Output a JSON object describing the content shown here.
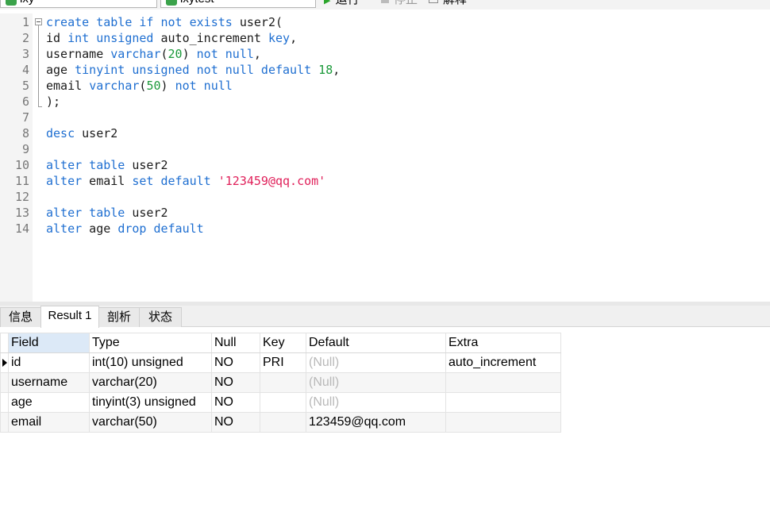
{
  "toolbar": {
    "connection": "lxy",
    "database": "lxytest",
    "run_label": "运行",
    "stop_label": "停止",
    "explain_label": "解释"
  },
  "editor": {
    "line_numbers": [
      "1",
      "2",
      "3",
      "4",
      "5",
      "6",
      "7",
      "8",
      "9",
      "10",
      "11",
      "12",
      "13",
      "14"
    ],
    "lines": [
      [
        {
          "t": "create table if not exists",
          "c": "kw"
        },
        {
          "t": " user2(",
          "c": "id"
        }
      ],
      [
        {
          "t": "id ",
          "c": "id"
        },
        {
          "t": "int unsigned",
          "c": "kw"
        },
        {
          "t": " auto_increment ",
          "c": "id"
        },
        {
          "t": "key",
          "c": "kw"
        },
        {
          "t": ",",
          "c": "id"
        }
      ],
      [
        {
          "t": "username ",
          "c": "id"
        },
        {
          "t": "varchar",
          "c": "kw"
        },
        {
          "t": "(",
          "c": "id"
        },
        {
          "t": "20",
          "c": "num"
        },
        {
          "t": ") ",
          "c": "id"
        },
        {
          "t": "not null",
          "c": "kw"
        },
        {
          "t": ",",
          "c": "id"
        }
      ],
      [
        {
          "t": "age ",
          "c": "id"
        },
        {
          "t": "tinyint unsigned not null default",
          "c": "kw"
        },
        {
          "t": " ",
          "c": "id"
        },
        {
          "t": "18",
          "c": "num"
        },
        {
          "t": ",",
          "c": "id"
        }
      ],
      [
        {
          "t": "email ",
          "c": "id"
        },
        {
          "t": "varchar",
          "c": "kw"
        },
        {
          "t": "(",
          "c": "id"
        },
        {
          "t": "50",
          "c": "num"
        },
        {
          "t": ") ",
          "c": "id"
        },
        {
          "t": "not null",
          "c": "kw"
        }
      ],
      [
        {
          "t": ");",
          "c": "id"
        }
      ],
      [],
      [
        {
          "t": "desc",
          "c": "kw"
        },
        {
          "t": " user2",
          "c": "id"
        }
      ],
      [],
      [
        {
          "t": "alter table",
          "c": "kw"
        },
        {
          "t": " user2",
          "c": "id"
        }
      ],
      [
        {
          "t": "alter",
          "c": "kw"
        },
        {
          "t": " email ",
          "c": "id"
        },
        {
          "t": "set default",
          "c": "kw"
        },
        {
          "t": " ",
          "c": "id"
        },
        {
          "t": "'123459@qq.com'",
          "c": "str"
        }
      ],
      [],
      [
        {
          "t": "alter table",
          "c": "kw"
        },
        {
          "t": " user2",
          "c": "id"
        }
      ],
      [
        {
          "t": "alter",
          "c": "kw"
        },
        {
          "t": " age ",
          "c": "id"
        },
        {
          "t": "drop default",
          "c": "kw"
        }
      ]
    ]
  },
  "result_tabs": [
    "信息",
    "Result 1",
    "剖析",
    "状态"
  ],
  "grid": {
    "columns": [
      "Field",
      "Type",
      "Null",
      "Key",
      "Default",
      "Extra"
    ],
    "rows": [
      [
        "id",
        "int(10) unsigned",
        "NO",
        "PRI",
        "(Null)",
        "auto_increment"
      ],
      [
        "username",
        "varchar(20)",
        "NO",
        "",
        "(Null)",
        ""
      ],
      [
        "age",
        "tinyint(3) unsigned",
        "NO",
        "",
        "(Null)",
        ""
      ],
      [
        "email",
        "varchar(50)",
        "NO",
        "",
        "123459@qq.com",
        ""
      ]
    ]
  }
}
